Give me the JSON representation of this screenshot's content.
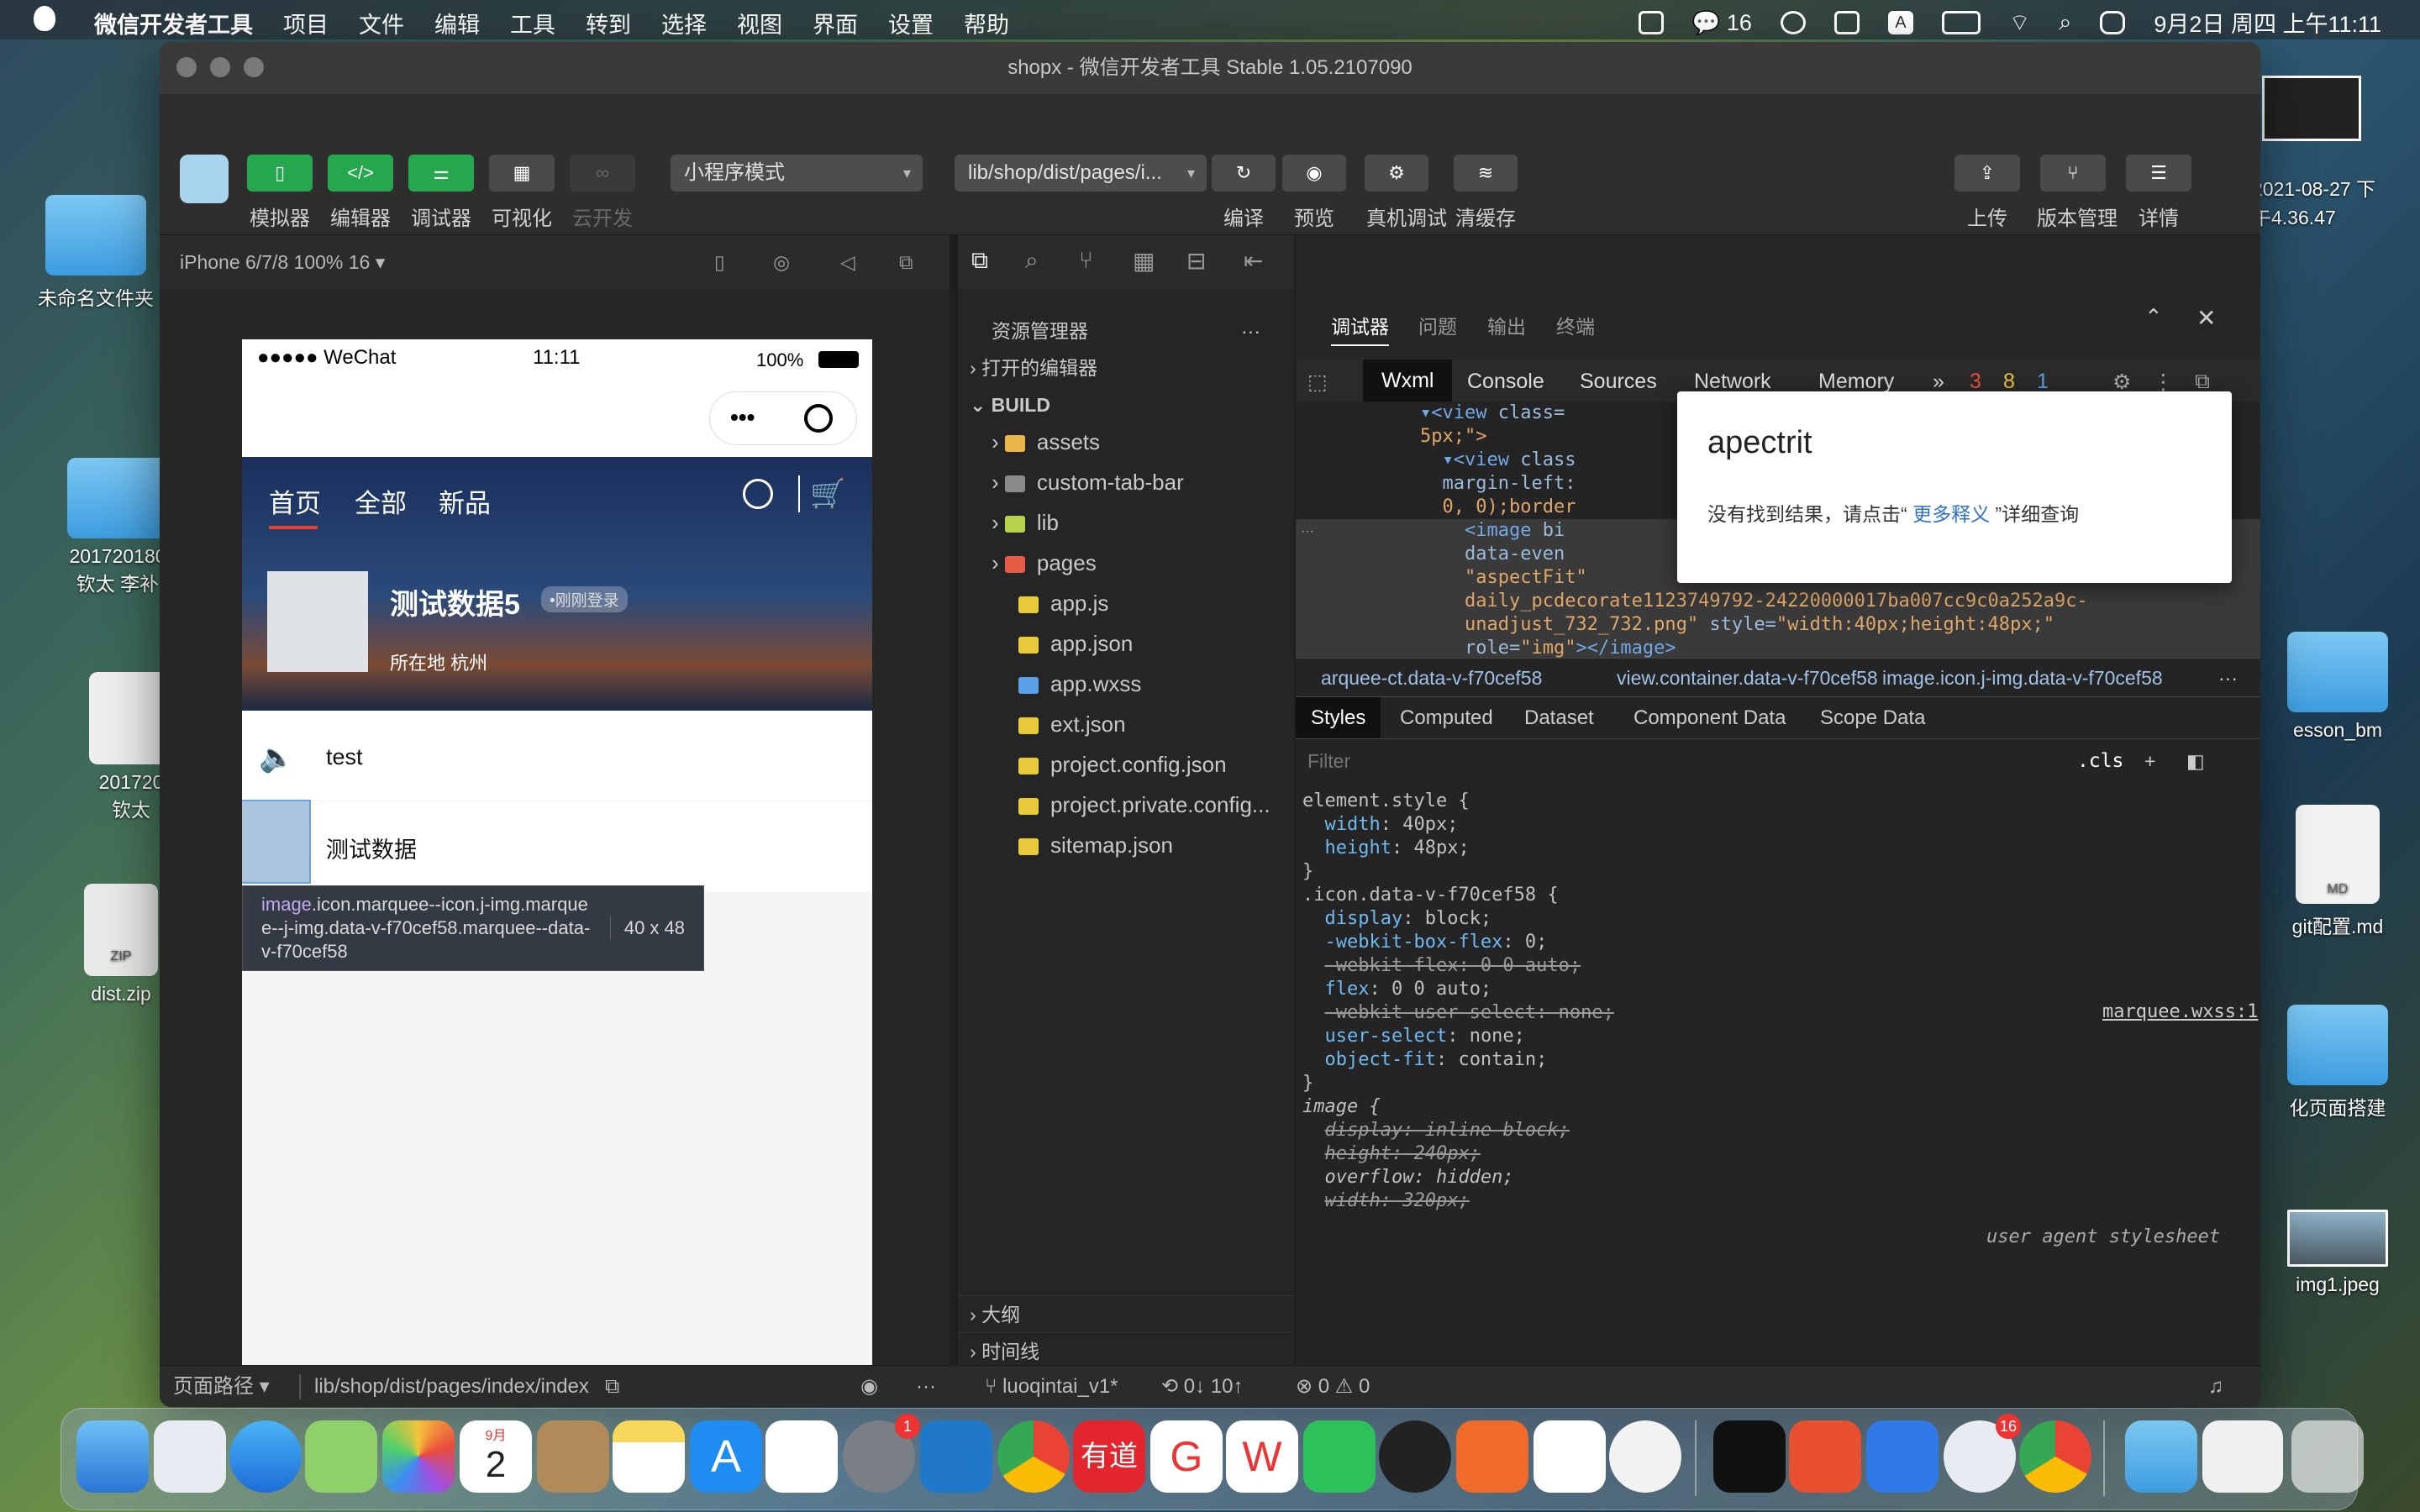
{
  "menubar": {
    "app_name": "微信开发者工具",
    "menus": [
      "项目",
      "文件",
      "编辑",
      "工具",
      "转到",
      "选择",
      "视图",
      "界面",
      "设置",
      "帮助"
    ],
    "notif_count": "16",
    "datetime": "9月2日 周四 上午11:11"
  },
  "window": {
    "title": "shopx - 微信开发者工具 Stable 1.05.2107090",
    "toolbar": {
      "buttons": [
        "模拟器",
        "编辑器",
        "调试器",
        "可视化",
        "云开发"
      ],
      "mode": "小程序模式",
      "path": "lib/shop/dist/pages/i...",
      "actions": [
        "编译",
        "预览",
        "真机调试",
        "清缓存"
      ],
      "right": [
        "上传",
        "版本管理",
        "详情"
      ]
    }
  },
  "simulator": {
    "device": "iPhone 6/7/8 100% 16 ▾",
    "status": {
      "carrier": "●●●●● WeChat",
      "time": "11:11",
      "battery": "100%"
    },
    "nav_tabs": [
      "首页",
      "全部",
      "新品"
    ],
    "profile": {
      "name": "测试数据5",
      "badge": "•刚刚登录",
      "location": "所在地 杭州"
    },
    "rows": [
      {
        "text": "test"
      },
      {
        "text": "测试数据"
      }
    ],
    "tooltip": {
      "selector_tag": "image",
      "selector_rest": ".icon.marquee--icon.j-img.marquee--j-img.data-v-f70cef58.marquee--data-v-f70cef58",
      "size": "40 x 48"
    }
  },
  "explorer": {
    "title": "资源管理器",
    "open_editors": "打开的编辑器",
    "root": "BUILD",
    "items": [
      {
        "name": "assets",
        "color": "#e8b64a"
      },
      {
        "name": "custom-tab-bar",
        "color": "#8a8a8a"
      },
      {
        "name": "lib",
        "color": "#b7d24b"
      },
      {
        "name": "pages",
        "color": "#e35d47"
      },
      {
        "name": "app.js",
        "color": "#e8c93a"
      },
      {
        "name": "app.json",
        "color": "#e8c93a"
      },
      {
        "name": "app.wxss",
        "color": "#5aa0e8"
      },
      {
        "name": "ext.json",
        "color": "#e8c93a"
      },
      {
        "name": "project.config.json",
        "color": "#e8c93a"
      },
      {
        "name": "project.private.config...",
        "color": "#e8c93a"
      },
      {
        "name": "sitemap.json",
        "color": "#e8c93a"
      }
    ],
    "outline": "大纲",
    "timeline": "时间线"
  },
  "devtools": {
    "panel_tabs": [
      "调试器",
      "问题",
      "输出",
      "终端"
    ],
    "tool_tabs": [
      "Wxml",
      "Console",
      "Sources",
      "Network",
      "Memory"
    ],
    "counts": {
      "errors": "3",
      "warnings": "8",
      "info": "1"
    },
    "breadcrumbs": [
      "arquee-ct.data-v-f70cef58",
      "view.container.data-v-f70cef58",
      "image.icon.j-img.data-v-f70cef58"
    ],
    "style_tabs": [
      "Styles",
      "Computed",
      "Dataset",
      "Component Data",
      "Scope Data"
    ],
    "filter_placeholder": "Filter",
    "cls": ".cls",
    "source_link": "marquee.wxss:1",
    "ua_label": "user agent stylesheet"
  },
  "popup": {
    "title": "apectrit",
    "text_before": "没有找到结果，请点击“ ",
    "link": "更多释义",
    "text_after": " ”详细查询"
  },
  "statusbar": {
    "path_label": "页面路径 ▾",
    "path": "lib/shop/dist/pages/index/index",
    "branch": "luoqintai_v1*",
    "sync": "0↓ 10↑",
    "problems": "0  ⚠ 0"
  },
  "desktop": [
    {
      "label": "未命名文件夹"
    },
    {
      "label": "201720180\n钦太 李补"
    },
    {
      "label": "201720\n钦太"
    },
    {
      "label": "dist.zip"
    },
    {
      "label": "2021-08-27 下\n午4.36.47"
    },
    {
      "label": "esson_bm"
    },
    {
      "label": "git配置.md"
    },
    {
      "label": "化页面搭建"
    },
    {
      "label": "img1.jpeg"
    }
  ],
  "dock": {
    "calendar_month": "9月",
    "calendar_day": "2",
    "badge1": "1",
    "badge2": "16"
  }
}
